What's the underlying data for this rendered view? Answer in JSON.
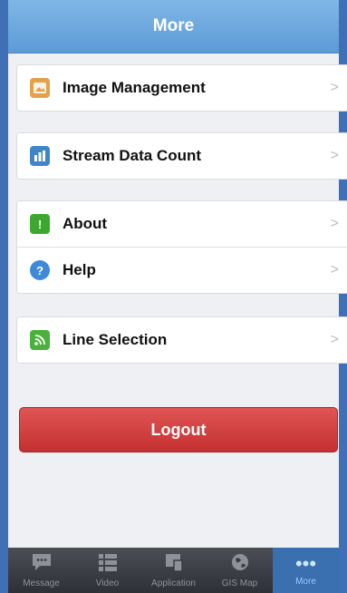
{
  "header": {
    "title": "More"
  },
  "groups": {
    "g1": [
      {
        "label": "Image Management",
        "icon": "image-management-icon",
        "color": "#e3a14a"
      }
    ],
    "g2": [
      {
        "label": "Stream Data Count",
        "icon": "bar-chart-icon",
        "color": "#3f86c9"
      }
    ],
    "g3": [
      {
        "label": "About",
        "icon": "exclamation-icon",
        "color": "#3ca82f"
      },
      {
        "label": "Help",
        "icon": "question-icon",
        "color": "#3e8ad8"
      }
    ],
    "g4": [
      {
        "label": "Line Selection",
        "icon": "rss-icon",
        "color": "#4ab23a"
      }
    ]
  },
  "logout_label": "Logout",
  "tabs": [
    {
      "label": "Message",
      "icon": "message-icon"
    },
    {
      "label": "Video",
      "icon": "video-list-icon"
    },
    {
      "label": "Application",
      "icon": "application-icon"
    },
    {
      "label": "GIS Map",
      "icon": "globe-icon"
    },
    {
      "label": "More",
      "icon": "more-dots-icon",
      "active": true
    }
  ],
  "colors": {
    "header": "#6aa6dc",
    "logout": "#d43d3d",
    "tabbar": "#3a3c42",
    "active_tab": "#3a6fb0"
  }
}
